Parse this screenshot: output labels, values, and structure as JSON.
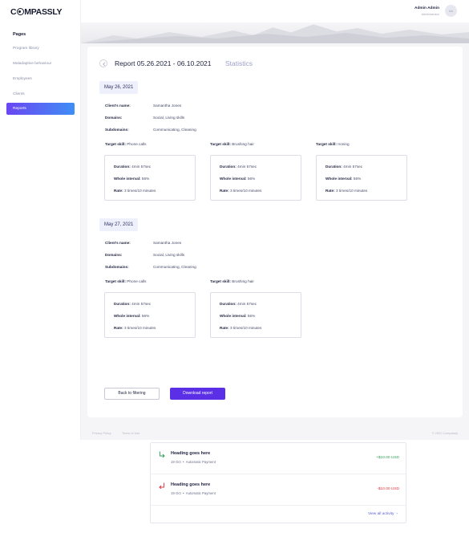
{
  "app": {
    "logo_text_1": "C",
    "logo_text_2": "MPASSLY"
  },
  "sidebar": {
    "section_title": "Pages",
    "items": [
      {
        "label": "Program library",
        "active": false
      },
      {
        "label": "Maladaptive behaviour",
        "active": false
      },
      {
        "label": "Employees",
        "active": false
      },
      {
        "label": "Clients",
        "active": false
      },
      {
        "label": "Reports",
        "active": true
      }
    ]
  },
  "header": {
    "user_name": "Admin Admin",
    "user_role": "Administrator",
    "avatar_initials": "AA"
  },
  "report": {
    "title": "Report 05.26.2021 - 06.10.2021",
    "subtitle": "Statistics",
    "labels": {
      "client_name": "Client's name:",
      "domains": "Domains:",
      "subdomains": "Subdomains:",
      "target_skill": "Target skill:",
      "duration": "Duration:",
      "whole_interval": "Whole interval:",
      "rate": "Rate:"
    },
    "sessions": [
      {
        "date": "May 26, 2021",
        "client_name": "Samantha Jones",
        "domains": "Social, Living skills",
        "subdomains": "Communicating, Cleaning",
        "skills": [
          {
            "target_skill": "Phone calls",
            "duration": "4min 57sec",
            "whole_interval": "56%",
            "rate": "3 times/10 minutes"
          },
          {
            "target_skill": "Brushing hair",
            "duration": "4min 57sec",
            "whole_interval": "56%",
            "rate": "3 times/10 minutes"
          },
          {
            "target_skill": "Ironing",
            "duration": "4min 57sec",
            "whole_interval": "56%",
            "rate": "3 times/10 minutes"
          }
        ]
      },
      {
        "date": "May 27, 2021",
        "client_name": "Samantha Jones",
        "domains": "Social, Living skills",
        "subdomains": "Communicating, Cleaning",
        "skills": [
          {
            "target_skill": "Phone calls",
            "duration": "4min 57sec",
            "whole_interval": "56%",
            "rate": "3 times/10 minutes"
          },
          {
            "target_skill": "Brushing hair",
            "duration": "4min 57sec",
            "whole_interval": "56%",
            "rate": "3 times/10 minutes"
          }
        ]
      }
    ],
    "buttons": {
      "back": "Back to filtering",
      "download": "Download report"
    }
  },
  "footer": {
    "privacy": "Privacy Policy",
    "terms": "Terms of Use",
    "copyright": "© 2021 Compassly"
  },
  "activity": {
    "items": [
      {
        "heading": "Heading goes here",
        "date": "19 Oct",
        "type": "Automatic Payment",
        "amount": "+$10.00 USD",
        "direction": "in",
        "color": "#2f9e57"
      },
      {
        "heading": "Heading goes here",
        "date": "19 Oct",
        "type": "Automatic Payment",
        "amount": "-$10.00 USD",
        "direction": "out",
        "color": "#e0353d"
      }
    ],
    "view_all": "View all activity"
  },
  "colors": {
    "accent": "#5a2fe6",
    "nav_gradient_start": "#6a46f2",
    "nav_gradient_end": "#3f8ef6"
  }
}
